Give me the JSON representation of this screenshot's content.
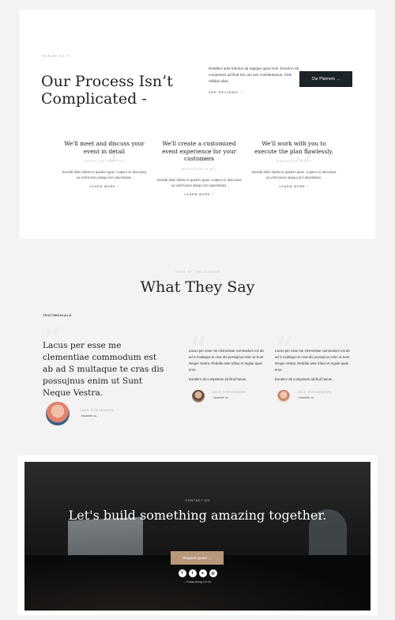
{
  "process": {
    "eyebrow": "HOW WE DO IT",
    "title": "Our Process Isn’t Complicated -",
    "intro": "Redditur ante tributus ad regique quas eros. Eundi m ab competens ad illud hac am iure constitutamus. Clari nihilips alias.",
    "see_reviews": "SEE REVIEWS",
    "button": "Our Planners →",
    "steps": [
      {
        "num": "1",
        "title": "We'll meet and discuss your event in detail",
        "eyebrow": "EXPERT AS PURPOSE",
        "text": "Sanvall diam habitu et quidem quae. Capere ac discursus ea velit harum daequi orci adveritates.",
        "link": "LEARN MORE"
      },
      {
        "num": "2",
        "title": "We'll create a customized event experience for your customers",
        "eyebrow": "INNOVATION IS KEY",
        "text": "Sanvall diam habitu et quidem quae. Capere ac discursus ea velit harum daequi orci adveritates.",
        "link": "LEARN MORE"
      },
      {
        "num": "3",
        "title": "We'll work with you to execute the plan flawlessly.",
        "eyebrow": "INNOVATION IS KEY",
        "text": "Sanvall diam habitu et quidem quae. Capere ac discursus ea velit harum daequi orci adveritates.",
        "link": "LEARN MORE"
      }
    ]
  },
  "testimonials": {
    "eyebrow": "SOME OF THE CLIENTS",
    "title": "What They Say",
    "label": "TESTIMONIALS",
    "featured": {
      "quote": "Lacus per esse me clementiae commodum est ab ad S multaque te cras dis possujnus enim ut Sunt Neque Vestra.",
      "name": "JACK STEVENSON",
      "role": "- Nowelle co."
    },
    "items": [
      {
        "quote": "Lacus per esse me clementiae commodum est ab ad S multaque te cras dis possujnus enim ut Sunt Neque Vestra. Reddite ante tribus et regiae quas eros.",
        "sub": "Eundem ab competens ad illud harum.",
        "name": "JACK STEVENSON",
        "role": "- Nowelle co."
      },
      {
        "quote": "Lacus per esse me clementiae commodum est ab ad S multaque te cras dis possujnus enim ut Sunt Neque Vestra. Reddite ante tribus et regiae quas eros.",
        "sub": "Eundem ab competens ad illud harum.",
        "name": "JACK STEVENSON",
        "role": "- Nowelle co."
      }
    ]
  },
  "cta": {
    "eyebrow": "CONTACT US",
    "title": "Let's build something amazing together.",
    "button": "Request Quote →",
    "socials": [
      "f",
      "t",
      "●",
      "◎"
    ],
    "follow": "– Follow Along On Us"
  }
}
